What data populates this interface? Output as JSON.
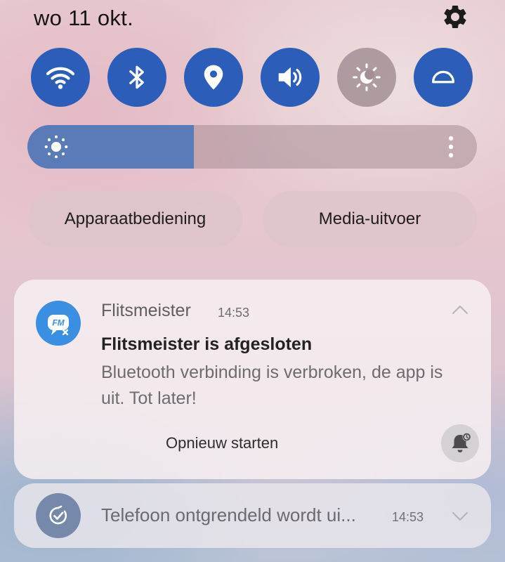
{
  "header": {
    "date": "wo 11 okt.",
    "settings_icon": "gear-icon"
  },
  "quick_settings": [
    {
      "name": "wifi",
      "icon": "wifi-icon",
      "on": true
    },
    {
      "name": "bluetooth",
      "icon": "bluetooth-icon",
      "on": true
    },
    {
      "name": "location",
      "icon": "location-pin-icon",
      "on": true
    },
    {
      "name": "sound",
      "icon": "volume-icon",
      "on": true
    },
    {
      "name": "eye-comfort",
      "icon": "sun-moon-icon",
      "on": false
    },
    {
      "name": "dark-mode",
      "icon": "half-circle-icon",
      "on": true
    }
  ],
  "brightness": {
    "level": 0.37,
    "icon": "sun-icon",
    "more_icon": "more-vertical-icon"
  },
  "pills": {
    "device_control": "Apparaatbediening",
    "media_output": "Media-uitvoer"
  },
  "notifications": [
    {
      "app_icon_text": "FM",
      "app": "Flitsmeister",
      "time": "14:53",
      "title": "Flitsmeister is afgesloten",
      "body": "Bluetooth verbinding is verbroken, de app is uit. Tot later!",
      "action": "Opnieuw starten"
    },
    {
      "icon": "check-clock-icon",
      "text": "Telefoon ontgrendeld wordt ui...",
      "time": "14:53"
    }
  ],
  "colors": {
    "tile_on": "#2c5db9",
    "tile_off": "#a38f95",
    "brightness_fill": "#5a7ab8",
    "app_icon": "#3b8fe3"
  }
}
